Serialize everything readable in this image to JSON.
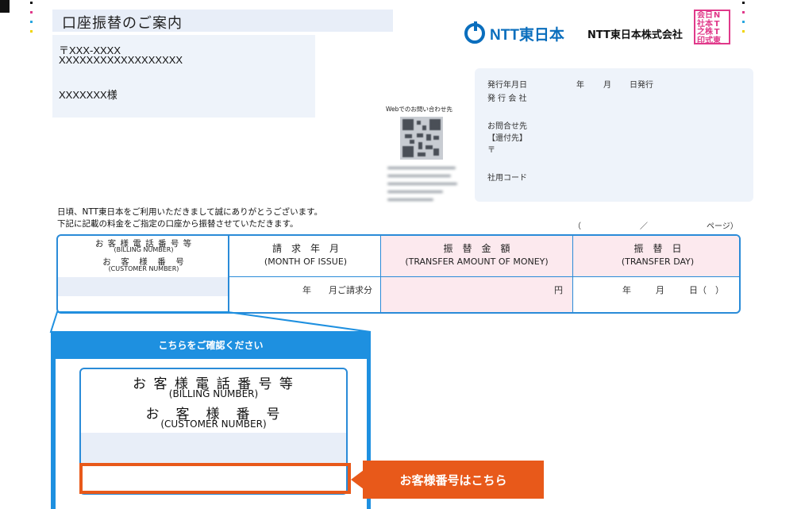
{
  "header": {
    "title": "口座振替のご案内"
  },
  "address": {
    "postal": "〒XXX-XXXX",
    "street": "XXXXXXXXXXXXXXXXXX",
    "recipient": "XXXXXXX様"
  },
  "brand": {
    "logo_text": "NTT東日本",
    "company_name": "NTT東日本株式会社",
    "seal_chars": [
      "会",
      "日",
      "N",
      "",
      "社",
      "本",
      "T",
      "",
      "之",
      "株",
      "T",
      "",
      "印",
      "式",
      "東",
      ""
    ],
    "logo_color": "#0a6ebd",
    "seal_color": "#e0398a"
  },
  "issuer": {
    "issue_date_label": "発行年月日",
    "year": "年",
    "month": "月",
    "day_issued": "日発行",
    "issuer_label": "発 行 会 社",
    "inquiry_label": "お問合せ先",
    "return_label": "【還付先】",
    "postal_mark": "〒",
    "internal_code_label": "社用コード"
  },
  "qr": {
    "label": "Webでのお問い合わせ先"
  },
  "greeting": {
    "line1": "日頃、NTT東日本をご利用いただきまして誠にありがとうございます。",
    "line2": "下記に記載の料金をご指定の口座から振替させていただきます。"
  },
  "page": {
    "open": "（",
    "slash": "／",
    "suffix": "ページ）"
  },
  "table": {
    "billing_number_jp": "お 客 様 電 話 番 号 等",
    "billing_number_en": "(BILLING NUMBER)",
    "customer_number_jp": "お　客　様　番　号",
    "customer_number_en": "(CUSTOMER NUMBER)",
    "month_issue_jp": "請　求　年　月",
    "month_issue_en": "(MONTH OF ISSUE)",
    "amount_jp": "振　替　金　額",
    "amount_en": "(TRANSFER AMOUNT OF MONEY)",
    "day_jp": "振　替　日",
    "day_en": "(TRANSFER DAY)",
    "month_value": "年　　月ご請求分",
    "amount_value": "円",
    "day_value_year": "年",
    "day_value_month": "月",
    "day_value_day": "日（　）",
    "accent_color": "#2a8bd8",
    "pink_bg": "#fce9ee"
  },
  "zoom": {
    "header": "こちらをご確認ください",
    "billing_number_jp": "お 客 様 電 話 番 号 等",
    "billing_number_en": "(BILLING NUMBER)",
    "customer_number_jp": "お　客　様　番　号",
    "customer_number_en": "(CUSTOMER NUMBER)"
  },
  "callout": {
    "label": "お客様番号はこちら",
    "color": "#e8591a"
  }
}
